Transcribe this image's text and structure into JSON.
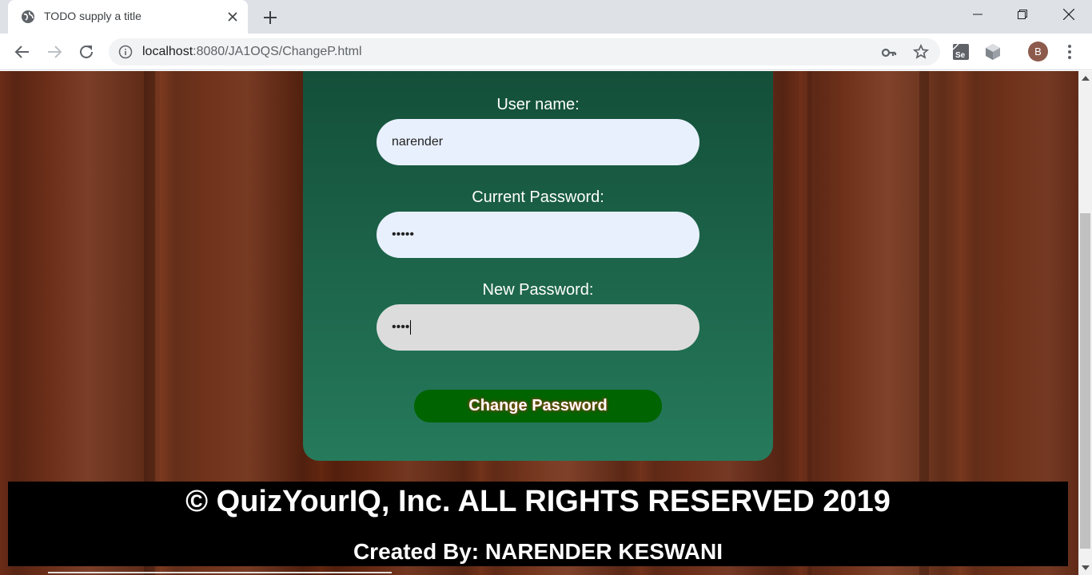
{
  "browser": {
    "tab_title": "TODO supply a title",
    "url_host": "localhost",
    "url_path": ":8080/JA1OQS/ChangeP.html",
    "profile_initial": "B"
  },
  "form": {
    "username_label": "User name:",
    "username_value": "narender",
    "current_password_label": "Current Password:",
    "current_password_value": "•••••",
    "new_password_label": "New Password:",
    "new_password_value": "••••",
    "submit_label": "Change Password"
  },
  "footer": {
    "copyright": "© QuizYourIQ, Inc. ALL RIGHTS RESERVED 2019",
    "credit": "Created By: NARENDER KESWANI"
  },
  "colors": {
    "card_top": "#134d38",
    "card_bottom": "#267a5c",
    "button": "#006400",
    "input_bg": "#e8f0fe",
    "footer_bg": "#000000"
  },
  "icons": [
    "globe-icon",
    "close-icon",
    "plus-icon",
    "minimize-icon",
    "restore-icon",
    "back-icon",
    "forward-icon",
    "reload-icon",
    "info-icon",
    "key-icon",
    "star-icon",
    "selenium-extension-icon",
    "cube-extension-icon",
    "more-icon"
  ]
}
